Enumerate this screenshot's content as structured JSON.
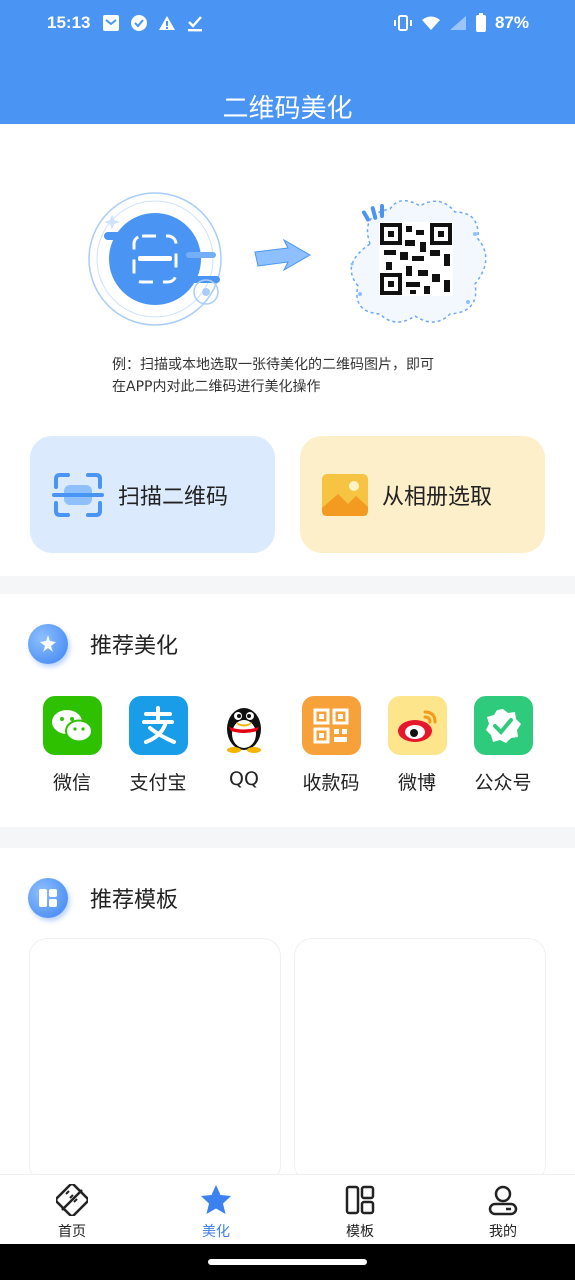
{
  "status": {
    "time": "15:13",
    "battery": "87%",
    "left_icons": [
      "mail-icon",
      "check-circle-icon",
      "warning-icon",
      "download-done-icon"
    ],
    "right_icons": [
      "vibrate-icon",
      "wifi-icon",
      "signal-icon",
      "battery-icon"
    ]
  },
  "header": {
    "title": "二维码美化"
  },
  "hero": {
    "note_line1": "例：扫描或本地选取一张待美化的二维码图片，即可",
    "note_line2": "在APP内对此二维码进行美化操作"
  },
  "actions": {
    "scan_label": "扫描二维码",
    "album_label": "从相册选取"
  },
  "recommend_beautify": {
    "title": "推荐美化",
    "apps": [
      {
        "name": "微信",
        "icon": "wechat-icon",
        "color": "#2dc100"
      },
      {
        "name": "支付宝",
        "icon": "alipay-icon",
        "color": "#1a9de8"
      },
      {
        "name": "QQ",
        "icon": "qq-penguin-icon",
        "color": "#000000"
      },
      {
        "name": "收款码",
        "icon": "payment-qr-icon",
        "color": "#f6a13a"
      },
      {
        "name": "微博",
        "icon": "weibo-icon",
        "color": "#e6162d"
      },
      {
        "name": "公众号",
        "icon": "official-account-icon",
        "color": "#2fcb7d"
      }
    ]
  },
  "recommend_templates": {
    "title": "推荐模板"
  },
  "tabbar": {
    "active_color": "#3b82f0",
    "tabs": [
      {
        "label": "首页",
        "icon": "pencil-ruler-icon"
      },
      {
        "label": "美化",
        "icon": "star-icon"
      },
      {
        "label": "模板",
        "icon": "template-grid-icon"
      },
      {
        "label": "我的",
        "icon": "user-icon"
      }
    ]
  },
  "colors": {
    "primary": "#4a95f3",
    "scan_bg": "#dceafd",
    "album_bg": "#feefcb"
  }
}
